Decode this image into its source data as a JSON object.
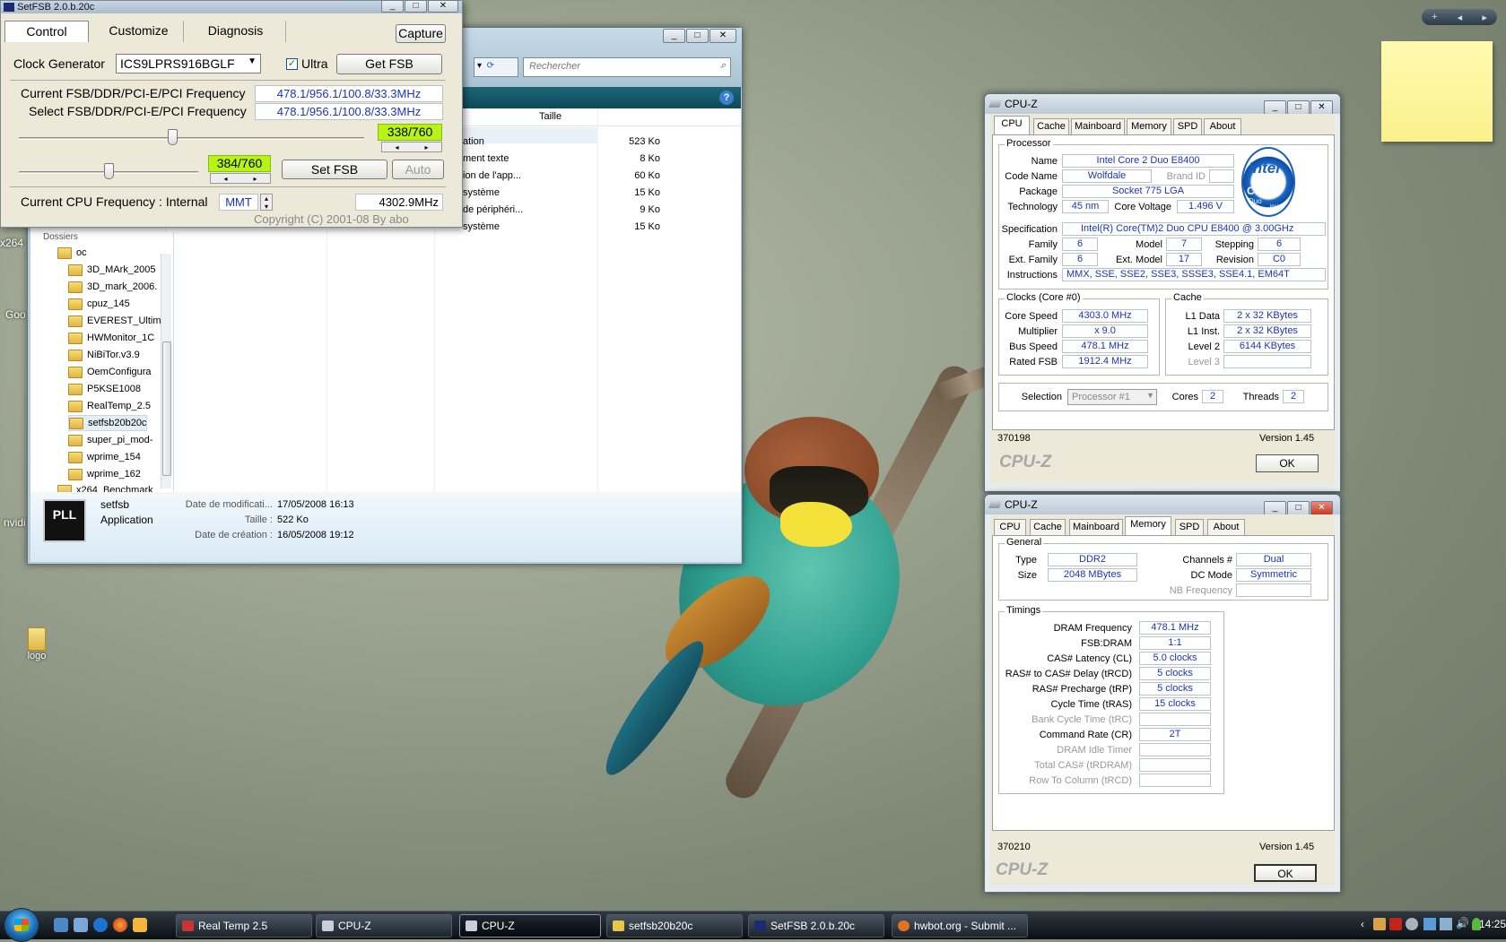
{
  "desktop": {
    "icons": [
      {
        "label": "logo"
      }
    ],
    "partial_labels": [
      "x264",
      "Goo",
      "nvidi"
    ]
  },
  "setfsb": {
    "title": "SetFSB 2.0.b.20c",
    "tabs": [
      "Control",
      "Customize",
      "Diagnosis"
    ],
    "capture": "Capture",
    "clock_label": "Clock Generator",
    "clock_value": "ICS9LPRS916BGLF",
    "ultra": "Ultra",
    "get_fsb": "Get FSB",
    "current_label": "Current FSB/DDR/PCI-E/PCI Frequency",
    "current_value": "478.1/956.1/100.8/33.3MHz",
    "select_label": "Select FSB/DDR/PCI-E/PCI Frequency",
    "select_value": "478.1/956.1/100.8/33.3MHz",
    "slider1": "338/760",
    "slider1_level": 0.445,
    "slider2": "384/760",
    "slider2_level": 0.505,
    "set_fsb": "Set FSB",
    "auto": "Auto",
    "cpu_label": "Current CPU Frequency : Internal",
    "mmt": "MMT",
    "cpu_value": "4302.9MHz",
    "copyright": "Copyright (C) 2001-08 By abo"
  },
  "explorer": {
    "search_placeholder": "Rechercher",
    "col_size": "Taille",
    "files": [
      {
        "name": "ation",
        "size": "523 Ko"
      },
      {
        "name": "ment texte",
        "size": "8 Ko"
      },
      {
        "name": "ion de l'app...",
        "size": "60 Ko"
      },
      {
        "name": "système",
        "size": "15 Ko"
      },
      {
        "name": "de périphéri...",
        "size": "9 Ko"
      },
      {
        "name": "système",
        "size": "15 Ko"
      }
    ],
    "tree_header": "Dossiers",
    "tree": [
      "oc",
      "3D_MArk_2005",
      "3D_mark_2006.",
      "cpuz_145",
      "EVEREST_Ultim",
      "HWMonitor_1C",
      "NiBiTor.v3.9",
      "OemConfigura",
      "P5KSE1008",
      "RealTemp_2.5",
      "setfsb20b20c",
      "super_pi_mod-",
      "wprime_154",
      "wprime_162",
      "x264_Benchmark"
    ],
    "details": {
      "name": "setfsb",
      "type": "Application",
      "mod_label": "Date de modificati...",
      "mod_value": "17/05/2008 16:13",
      "size_label": "Taille :",
      "size_value": "522 Ko",
      "created_label": "Date de création :",
      "created_value": "16/05/2008 19:12",
      "icon_text": "PLL"
    }
  },
  "cpuz1": {
    "title": "CPU-Z",
    "tabs": [
      "CPU",
      "Cache",
      "Mainboard",
      "Memory",
      "SPD",
      "About"
    ],
    "processor": "Processor",
    "name_l": "Name",
    "name": "Intel Core 2 Duo E8400",
    "codename_l": "Code Name",
    "codename": "Wolfdale",
    "brand_l": "Brand ID",
    "package_l": "Package",
    "package": "Socket 775 LGA",
    "tech_l": "Technology",
    "tech": "45 nm",
    "cv_l": "Core Voltage",
    "cv": "1.496 V",
    "spec_l": "Specification",
    "spec": "Intel(R) Core(TM)2 Duo CPU     E8400  @ 3.00GHz",
    "family_l": "Family",
    "family": "6",
    "model_l": "Model",
    "model": "7",
    "stepping_l": "Stepping",
    "stepping": "6",
    "extfam_l": "Ext. Family",
    "extfam": "6",
    "extmodel_l": "Ext. Model",
    "extmodel": "17",
    "revision_l": "Revision",
    "revision": "C0",
    "instr_l": "Instructions",
    "instr": "MMX, SSE, SSE2, SSE3, SSSE3, SSE4.1, EM64T",
    "clocks": "Clocks (Core #0)",
    "cs_l": "Core Speed",
    "cs": "4303.0 MHz",
    "mult_l": "Multiplier",
    "mult": "x 9.0",
    "bus_l": "Bus Speed",
    "bus": "478.1 MHz",
    "rfsb_l": "Rated FSB",
    "rfsb": "1912.4 MHz",
    "cache": "Cache",
    "l1d_l": "L1 Data",
    "l1d": "2 x 32 KBytes",
    "l1i_l": "L1 Inst.",
    "l1i": "2 x 32 KBytes",
    "l2_l": "Level 2",
    "l2": "6144 KBytes",
    "l3_l": "Level 3",
    "sel_l": "Selection",
    "sel": "Processor #1",
    "cores_l": "Cores",
    "cores": "2",
    "threads_l": "Threads",
    "threads": "2",
    "id": "370198",
    "version": "Version 1.45",
    "brand": "CPU-Z",
    "ok": "OK",
    "logo": {
      "l1": "intel",
      "l2": "Core 2",
      "l3": "Duo",
      "l4": "inside"
    }
  },
  "cpuz2": {
    "title": "CPU-Z",
    "tabs": [
      "CPU",
      "Cache",
      "Mainboard",
      "Memory",
      "SPD",
      "About"
    ],
    "general": "General",
    "type_l": "Type",
    "type": "DDR2",
    "size_l": "Size",
    "size": "2048 MBytes",
    "ch_l": "Channels #",
    "ch": "Dual",
    "dc_l": "DC Mode",
    "dc": "Symmetric",
    "nb_l": "NB Frequency",
    "timings": "Timings",
    "t": [
      {
        "l": "DRAM Frequency",
        "v": "478.1 MHz"
      },
      {
        "l": "FSB:DRAM",
        "v": "1:1"
      },
      {
        "l": "CAS# Latency (CL)",
        "v": "5.0 clocks"
      },
      {
        "l": "RAS# to CAS# Delay (tRCD)",
        "v": "5 clocks"
      },
      {
        "l": "RAS# Precharge (tRP)",
        "v": "5 clocks"
      },
      {
        "l": "Cycle Time (tRAS)",
        "v": "15 clocks"
      },
      {
        "l": "Bank Cycle Time (tRC)",
        "v": ""
      },
      {
        "l": "Command Rate (CR)",
        "v": "2T"
      },
      {
        "l": "DRAM Idle Timer",
        "v": ""
      },
      {
        "l": "Total CAS# (tRDRAM)",
        "v": ""
      },
      {
        "l": "Row To Column (tRCD)",
        "v": ""
      }
    ],
    "id": "370210",
    "version": "Version 1.45",
    "brand": "CPU-Z",
    "ok": "OK"
  },
  "taskbar": {
    "tasks": [
      "Real Temp 2.5",
      "CPU-Z",
      "CPU-Z",
      "setfsb20b20c",
      "SetFSB 2.0.b.20c",
      "hwbot.org - Submit ..."
    ],
    "clock": "14:25"
  },
  "colors": {
    "green_slider": "#b8f316",
    "value_blue": "#1a35b5",
    "taskbar": "#1c242c"
  }
}
